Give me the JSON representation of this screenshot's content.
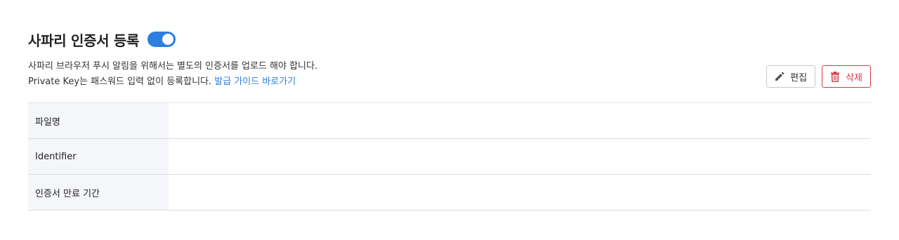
{
  "section": {
    "title": "사파리 인증서 등록",
    "toggle_on": true,
    "description_line1": "사파리 브라우저 푸시 알림을 위해서는 별도의 인증서를 업로드 해야 합니다.",
    "description_line2": "Private Key는 패스워드 입력 없이 등록합니다.",
    "guide_link": "발급 가이드 바로가기"
  },
  "actions": {
    "edit_label": "편집",
    "edit_icon": "pencil-icon",
    "delete_label": "삭제",
    "delete_icon": "trash-icon"
  },
  "colors": {
    "accent": "#2e7de1",
    "danger": "#d23a46",
    "label_bg": "#f5f6fa"
  },
  "table": {
    "rows": [
      {
        "label": "파일명",
        "value": ""
      },
      {
        "label": "Identifier",
        "value": ""
      },
      {
        "label": "인증서 만료 기간",
        "value": ""
      }
    ]
  }
}
